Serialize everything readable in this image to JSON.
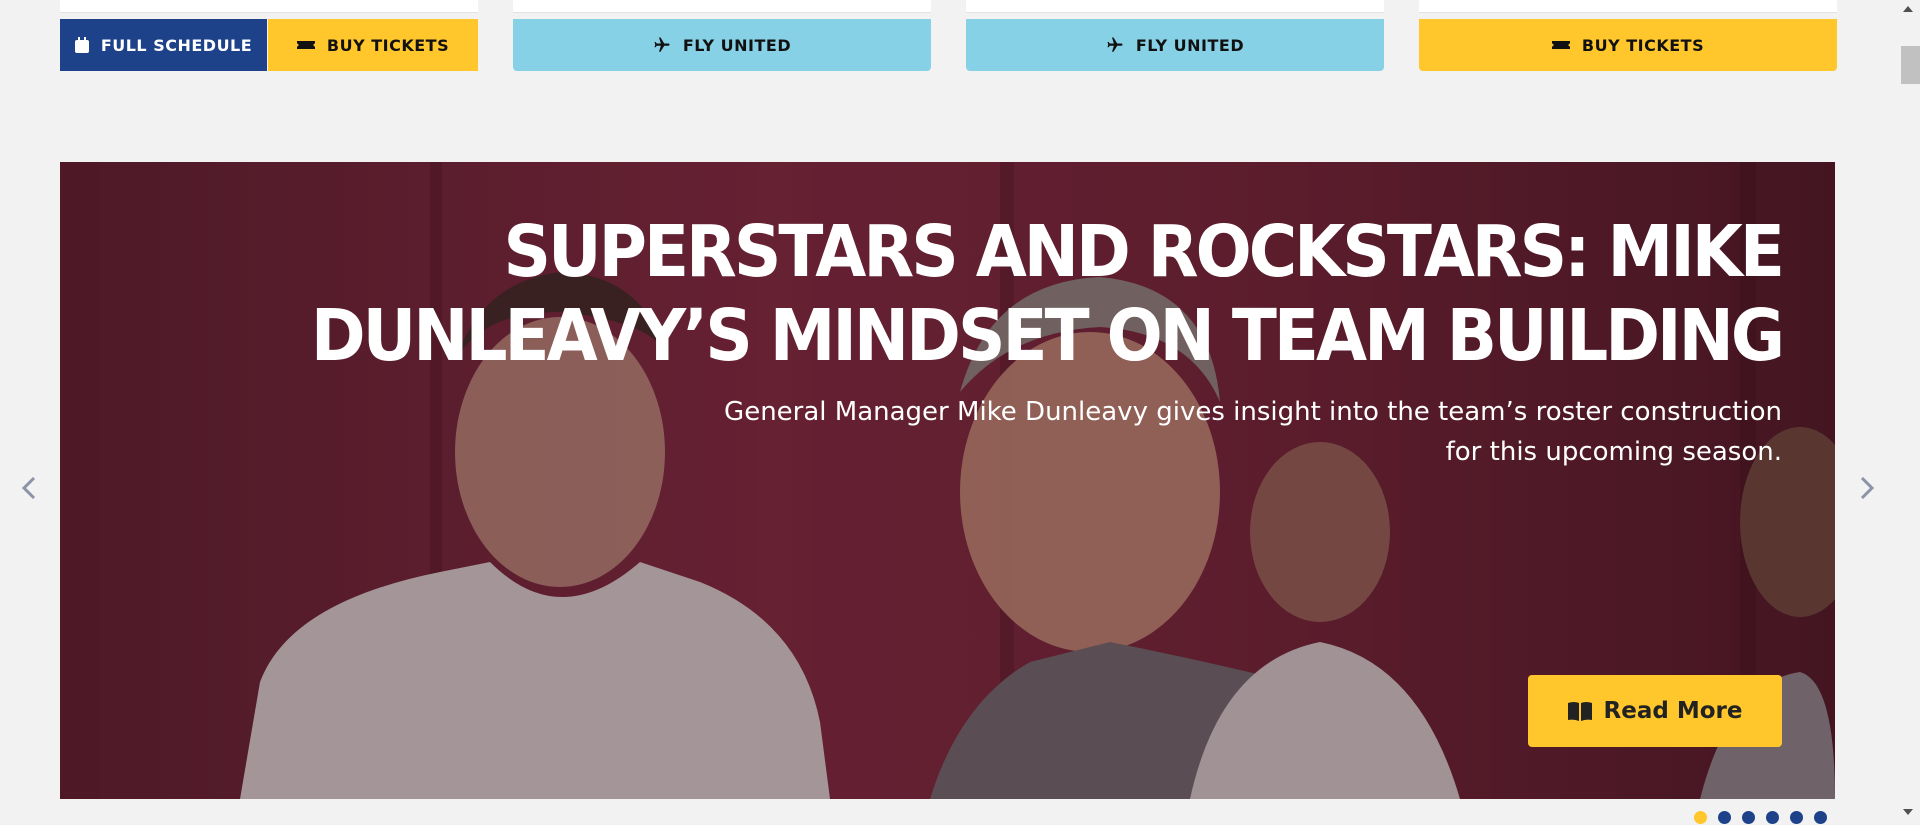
{
  "top_cards": {
    "card1": {
      "schedule_label": "FULL SCHEDULE",
      "tickets_label": "BUY TICKETS"
    },
    "card2": {
      "fly_label": "FLY UNITED"
    },
    "card3": {
      "fly_label": "FLY UNITED"
    },
    "card4": {
      "tickets_label": "BUY TICKETS"
    }
  },
  "hero": {
    "headline": "SUPERSTARS AND ROCKSTARS: MIKE DUNLEAVY’S MINDSET ON TEAM BUILDING",
    "subtext": "General Manager Mike Dunleavy gives insight into the team’s roster construction for this upcoming season.",
    "cta_label": "Read More"
  },
  "carousel": {
    "slide_count": 6,
    "active_index": 0
  },
  "icons": {
    "calendar": "calendar-icon",
    "ticket": "ticket-icon",
    "plane": "plane-icon",
    "book": "book-open-icon",
    "prev": "chevron-left-icon",
    "next": "chevron-right-icon"
  },
  "colors": {
    "brand_blue": "#1d428a",
    "brand_yellow": "#ffc72c",
    "sky": "#87d1e6",
    "hero_bg": "#7d2a3f"
  }
}
